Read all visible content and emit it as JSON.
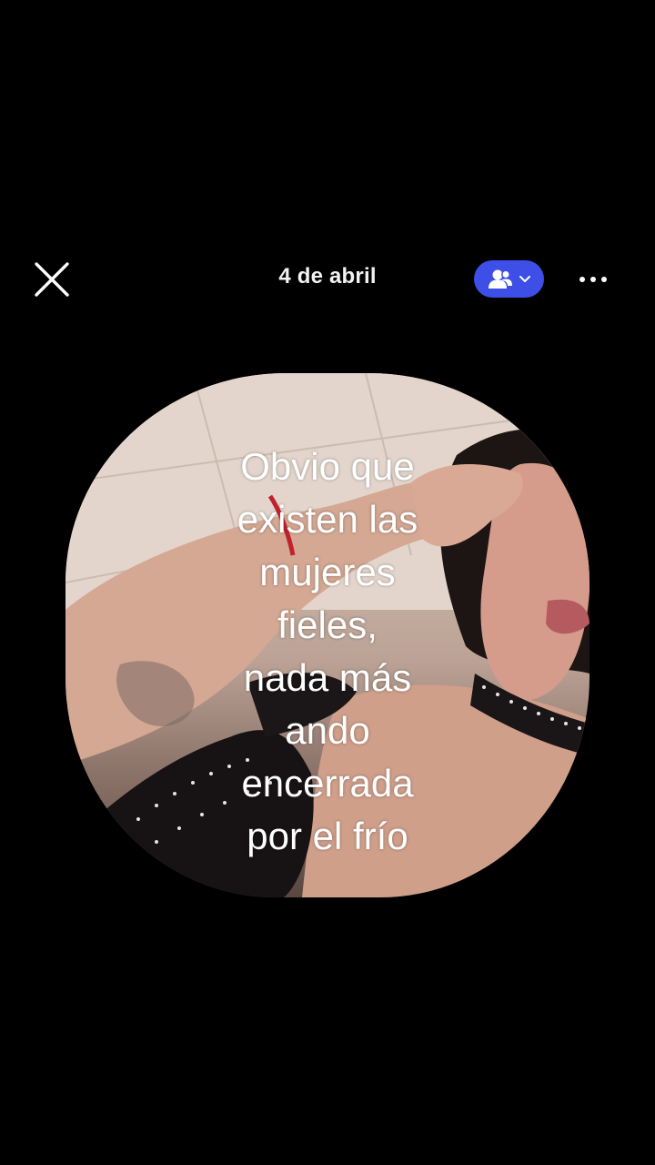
{
  "header": {
    "date": "4 de abril",
    "icons": {
      "close": "close-icon",
      "audience": "friends-icon",
      "audience_chevron": "chevron-down-icon",
      "more": "more-dots-icon"
    },
    "accent_color": "#3d4fe6"
  },
  "story": {
    "caption_lines": [
      "Obvio que",
      "existen las",
      "mujeres",
      "fieles,",
      "nada más",
      "ando",
      "encerrada",
      "por el frío"
    ]
  }
}
